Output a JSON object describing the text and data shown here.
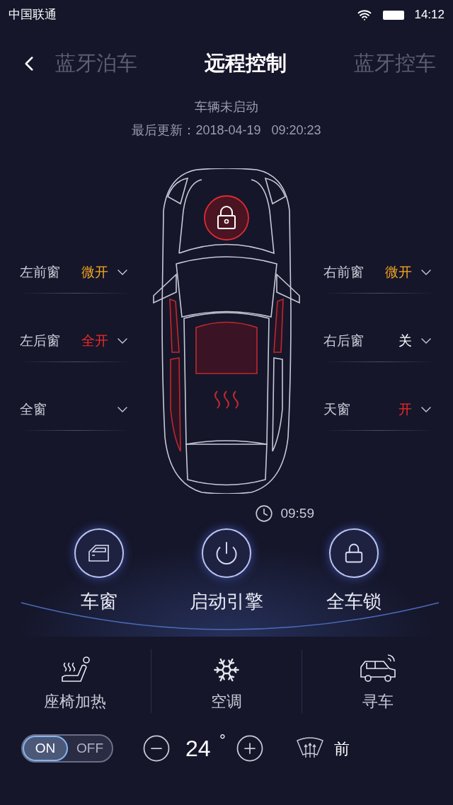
{
  "status_bar": {
    "carrier": "中国联通",
    "time": "14:12"
  },
  "tabs": [
    {
      "label": "蓝牙泊车",
      "selected": false
    },
    {
      "label": "远程控制",
      "selected": true
    },
    {
      "label": "蓝牙控车",
      "selected": false
    }
  ],
  "vehicle": {
    "status": "车辆未启动",
    "last_update": "最后更新：2018-04-19   09:20:23",
    "locked": true
  },
  "windows_left": [
    {
      "label": "左前窗",
      "value": "微开",
      "color": "#f5a623"
    },
    {
      "label": "左后窗",
      "value": "全开",
      "color": "#ee2a2a"
    },
    {
      "label": "全窗"
    }
  ],
  "windows_right": [
    {
      "label": "右前窗",
      "value": "微开",
      "color": "#f5a623"
    },
    {
      "label": "右后窗",
      "value": "关",
      "color": "#ffffff"
    },
    {
      "label": "天窗",
      "value": "开",
      "color": "#ee2a2a"
    }
  ],
  "timer": "09:59",
  "actions": [
    {
      "kind": "window",
      "label": "车窗"
    },
    {
      "kind": "power",
      "label": "启动引擎"
    },
    {
      "kind": "lock",
      "label": "全车锁"
    }
  ],
  "features": [
    {
      "kind": "seat",
      "label": "座椅加热"
    },
    {
      "kind": "ac",
      "label": "空调"
    },
    {
      "kind": "find",
      "label": "寻车"
    }
  ],
  "controls": {
    "toggle": {
      "on_label": "ON",
      "off_label": "OFF",
      "on": true
    },
    "temperature": "24",
    "unit": "°",
    "defrost": "前"
  }
}
